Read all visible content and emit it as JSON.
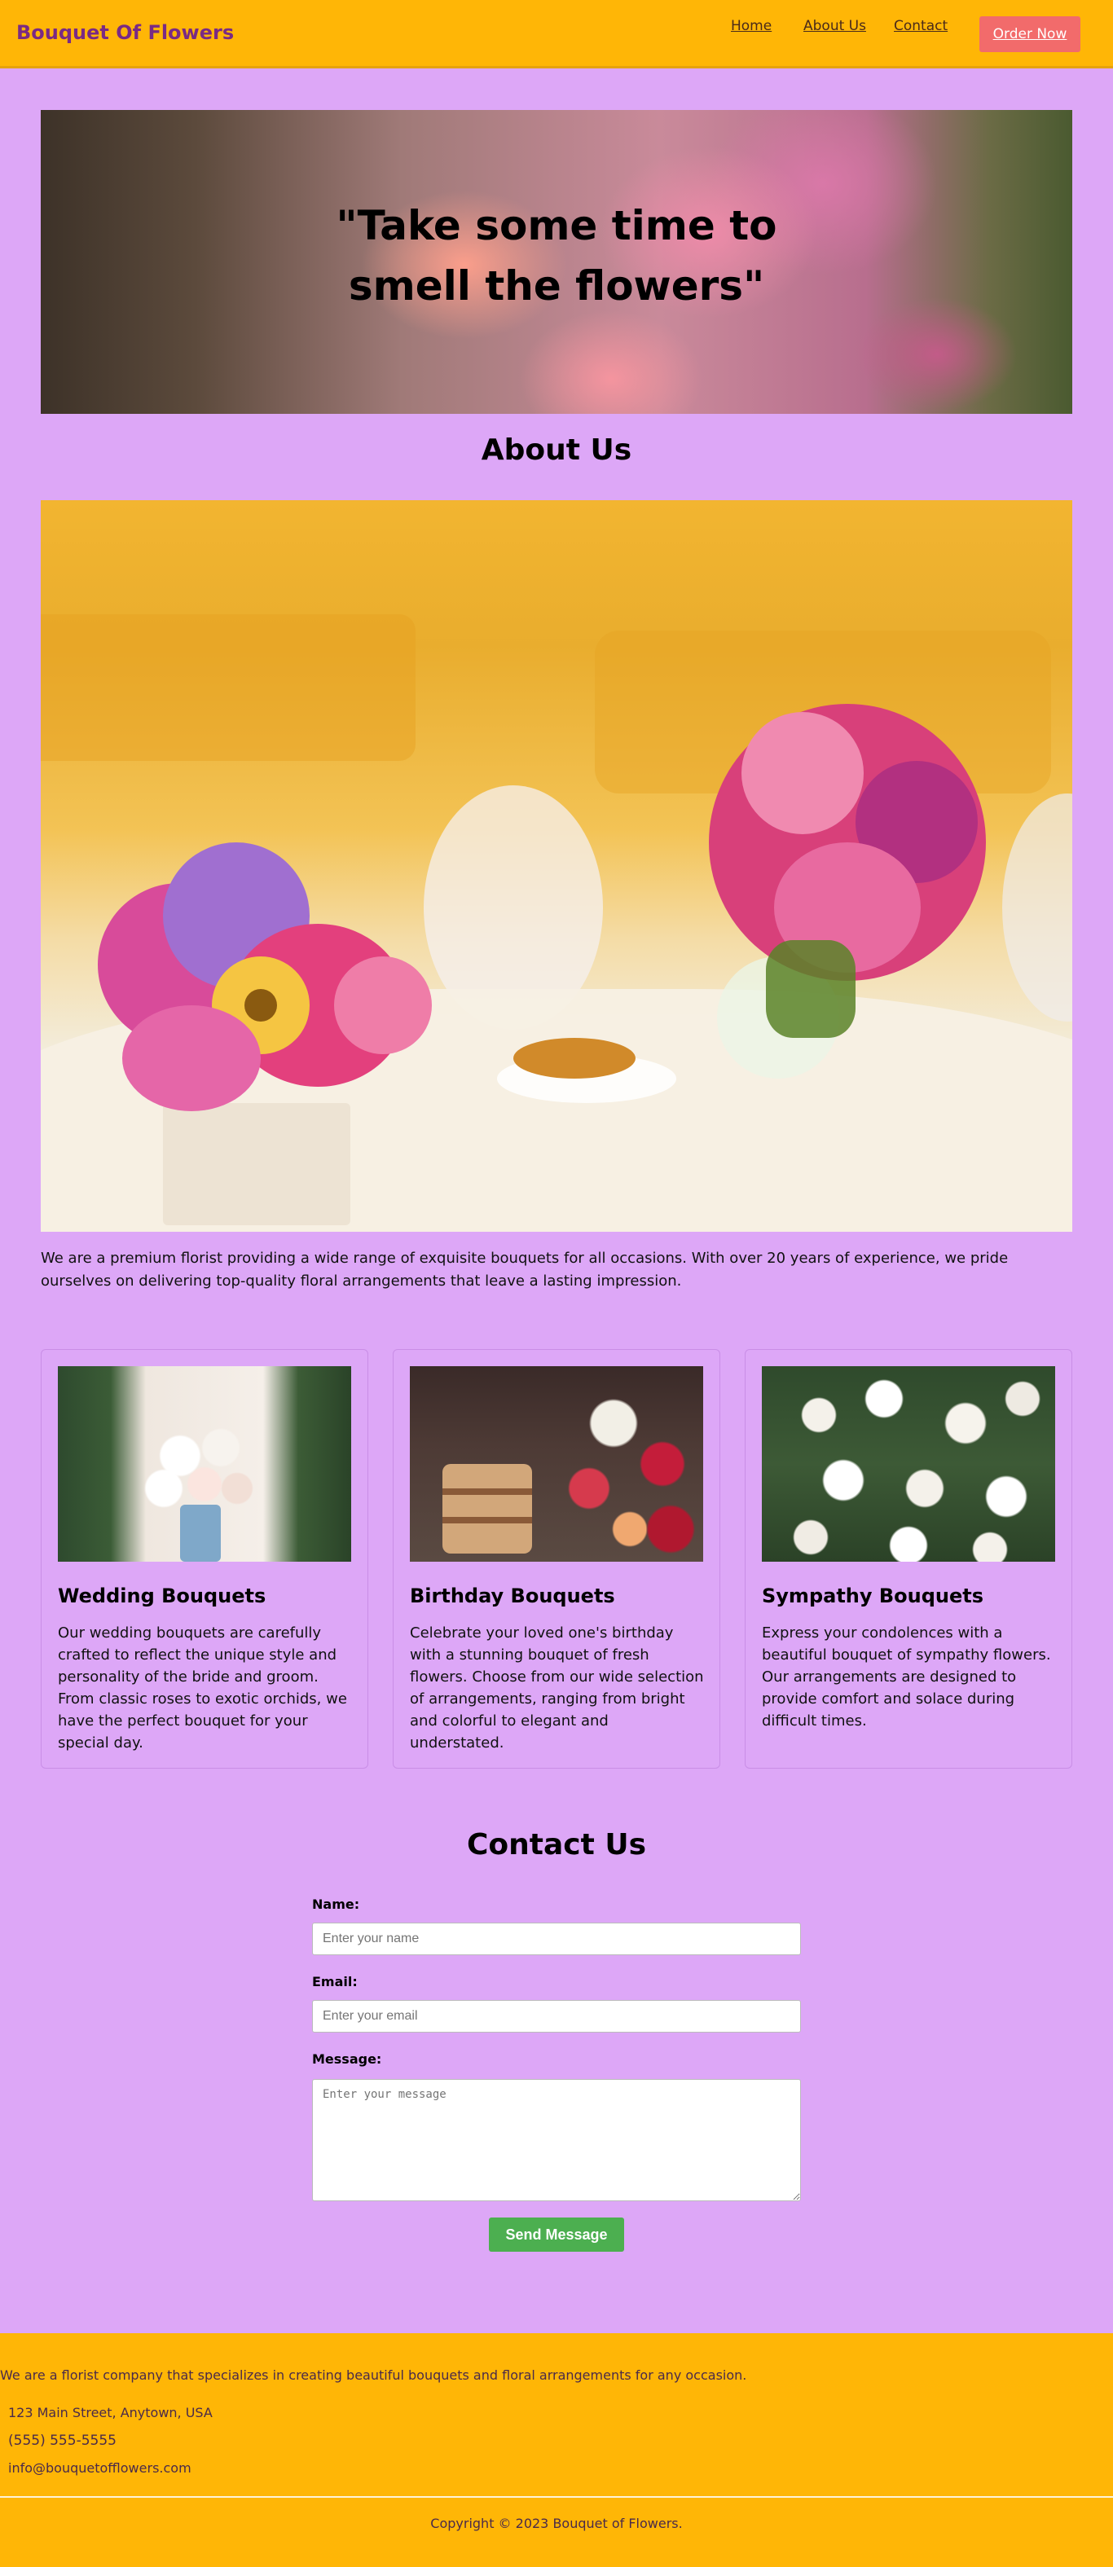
{
  "header": {
    "brand": "Bouquet Of Flowers",
    "nav": [
      "Home",
      "About Us",
      "Contact"
    ],
    "order_label": "Order Now"
  },
  "hero": {
    "quote_line1": "\"Take some time to",
    "quote_line2": "smell the flowers\""
  },
  "about": {
    "title": "About Us",
    "text": "We are a premium florist providing a wide range of exquisite bouquets for all occasions. With over 20 years of experience, we pride ourselves on delivering top-quality floral arrangements that leave a lasting impression."
  },
  "services": [
    {
      "title": "Wedding Bouquets",
      "description": "Our wedding bouquets are carefully crafted to reflect the unique style and personality of the bride and groom. From classic roses to exotic orchids, we have the perfect bouquet for your special day."
    },
    {
      "title": "Birthday Bouquets",
      "description": "Celebrate your loved one's birthday with a stunning bouquet of fresh flowers. Choose from our wide selection of arrangements, ranging from bright and colorful to elegant and understated."
    },
    {
      "title": "Sympathy Bouquets",
      "description": "Express your condolences with a beautiful bouquet of sympathy flowers. Our arrangements are designed to provide comfort and solace during difficult times."
    }
  ],
  "contact": {
    "title": "Contact Us",
    "name_label": "Name:",
    "name_placeholder": "Enter your name",
    "email_label": "Email:",
    "email_placeholder": "Enter your email",
    "message_label": "Message:",
    "message_placeholder": "Enter your message",
    "submit_label": "Send Message"
  },
  "footer": {
    "tagline": "We are a florist company that specializes in creating beautiful bouquets and floral arrangements for any occasion.",
    "address": "123 Main Street, Anytown, USA",
    "phone": "(555) 555-5555",
    "email": "info@bouquetofflowers.com",
    "copyright": "Copyright © 2023 Bouquet of Flowers."
  },
  "colors": {
    "page_background": "#dda7f7",
    "header_background": "#ffb606",
    "brand_text": "#7a2a84",
    "order_button": "#f26b6b",
    "send_button": "#4caf50"
  }
}
